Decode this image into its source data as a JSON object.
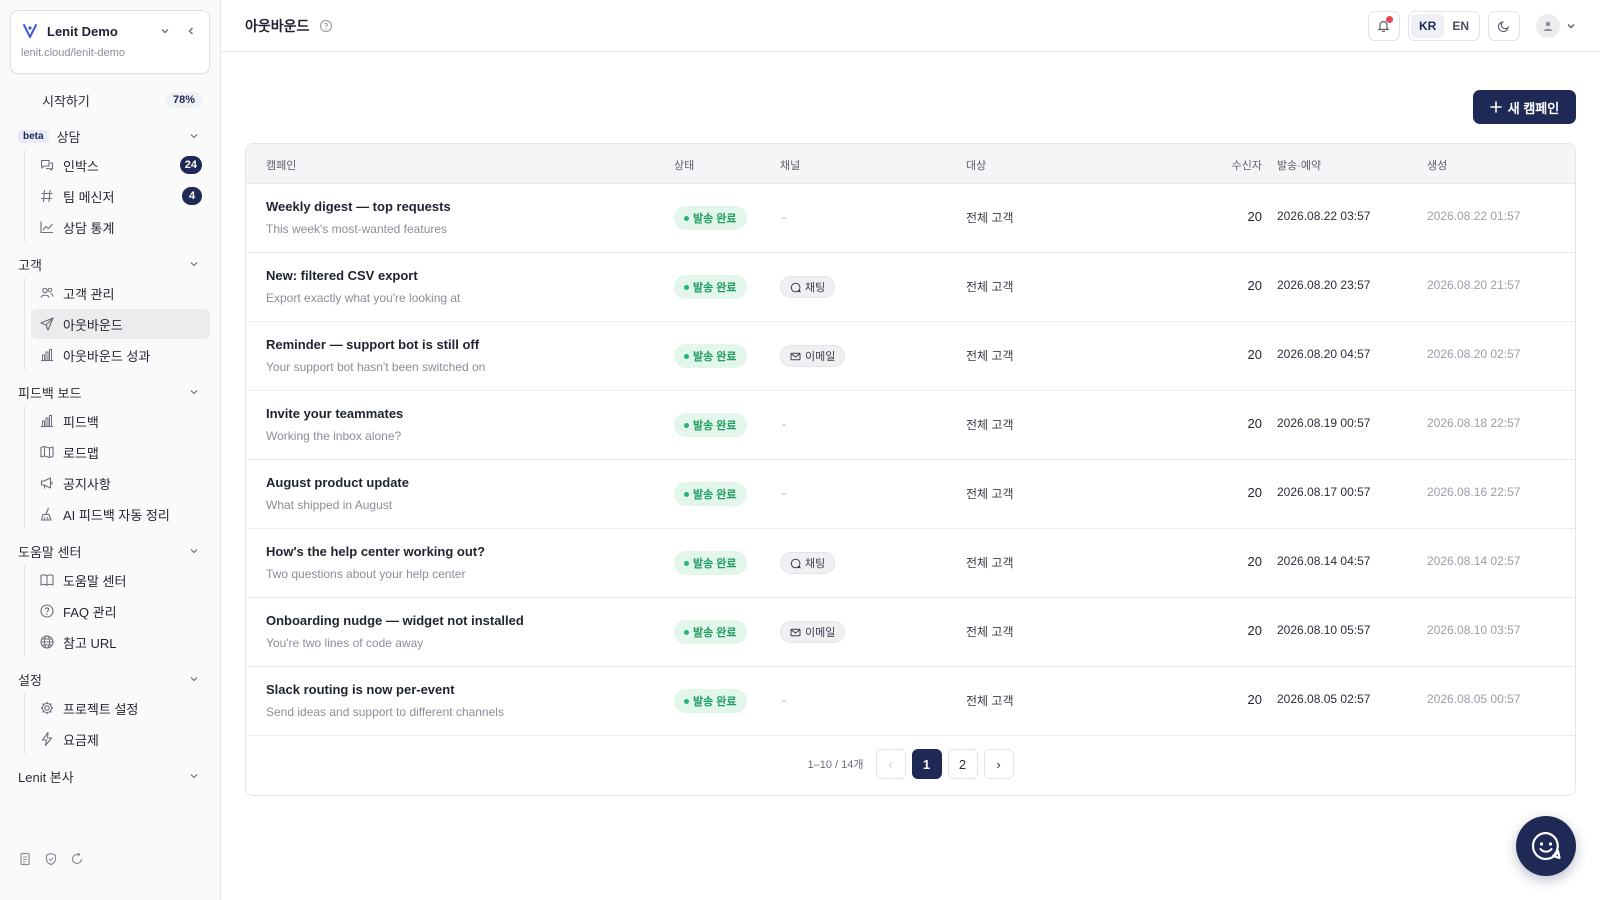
{
  "workspace": {
    "name": "Lenit Demo",
    "url": "lenit.cloud/lenit-demo"
  },
  "sidebar": {
    "start": {
      "label": "시작하기",
      "progress": "78%"
    },
    "sections": [
      {
        "title": "상담",
        "beta": "beta",
        "items": [
          {
            "label": "인박스",
            "icon": "chat-bubbles-icon",
            "badge": "24"
          },
          {
            "label": "팀 메신저",
            "icon": "hash-icon",
            "badge": "4"
          },
          {
            "label": "상담 통계",
            "icon": "line-chart-icon"
          }
        ]
      },
      {
        "title": "고객",
        "items": [
          {
            "label": "고객 관리",
            "icon": "users-icon"
          },
          {
            "label": "아웃바운드",
            "icon": "send-icon",
            "active": true
          },
          {
            "label": "아웃바운드 성과",
            "icon": "bar-chart-icon"
          }
        ]
      },
      {
        "title": "피드백 보드",
        "items": [
          {
            "label": "피드백",
            "icon": "bar-chart-icon"
          },
          {
            "label": "로드맵",
            "icon": "map-icon"
          },
          {
            "label": "공지사항",
            "icon": "megaphone-icon"
          },
          {
            "label": "AI 피드백 자동 정리",
            "icon": "ai-broom-icon"
          }
        ]
      },
      {
        "title": "도움말 센터",
        "items": [
          {
            "label": "도움말 센터",
            "icon": "book-icon"
          },
          {
            "label": "FAQ 관리",
            "icon": "question-icon"
          },
          {
            "label": "참고 URL",
            "icon": "globe-icon"
          }
        ]
      },
      {
        "title": "설정",
        "items": [
          {
            "label": "프로젝트 설정",
            "icon": "gear-icon"
          },
          {
            "label": "요금제",
            "icon": "bolt-icon"
          }
        ]
      },
      {
        "title": "Lenit 본사",
        "items": []
      }
    ]
  },
  "header": {
    "title": "아웃바운드",
    "lang_kr": "KR",
    "lang_en": "EN",
    "selected_lang": "KR"
  },
  "actions": {
    "new_campaign": "새 캠페인"
  },
  "table": {
    "columns": {
      "campaign": "캠페인",
      "status": "상태",
      "channel": "채널",
      "target": "대상",
      "recipients": "수신자",
      "sent": "발송·예약",
      "created": "생성"
    },
    "rows": [
      {
        "title": "Weekly digest — top requests",
        "subtitle": "This week's most-wanted features",
        "status": "발송 완료",
        "channel": "-",
        "channel_icon": "",
        "target": "전체 고객",
        "recipients": "20",
        "sent": "2026.08.22 03:57",
        "created": "2026.08.22 01:57"
      },
      {
        "title": "New: filtered CSV export",
        "subtitle": "Export exactly what you're looking at",
        "status": "발송 완료",
        "channel": "채팅",
        "channel_icon": "chat",
        "target": "전체 고객",
        "recipients": "20",
        "sent": "2026.08.20 23:57",
        "created": "2026.08.20 21:57"
      },
      {
        "title": "Reminder — support bot is still off",
        "subtitle": "Your support bot hasn't been switched on",
        "status": "발송 완료",
        "channel": "이메일",
        "channel_icon": "mail",
        "target": "전체 고객",
        "recipients": "20",
        "sent": "2026.08.20 04:57",
        "created": "2026.08.20 02:57"
      },
      {
        "title": "Invite your teammates",
        "subtitle": "Working the inbox alone?",
        "status": "발송 완료",
        "channel": "-",
        "channel_icon": "",
        "target": "전체 고객",
        "recipients": "20",
        "sent": "2026.08.19 00:57",
        "created": "2026.08.18 22:57"
      },
      {
        "title": "August product update",
        "subtitle": "What shipped in August",
        "status": "발송 완료",
        "channel": "-",
        "channel_icon": "",
        "target": "전체 고객",
        "recipients": "20",
        "sent": "2026.08.17 00:57",
        "created": "2026.08.16 22:57"
      },
      {
        "title": "How's the help center working out?",
        "subtitle": "Two questions about your help center",
        "status": "발송 완료",
        "channel": "채팅",
        "channel_icon": "chat",
        "target": "전체 고객",
        "recipients": "20",
        "sent": "2026.08.14 04:57",
        "created": "2026.08.14 02:57"
      },
      {
        "title": "Onboarding nudge — widget not installed",
        "subtitle": "You're two lines of code away",
        "status": "발송 완료",
        "channel": "이메일",
        "channel_icon": "mail",
        "target": "전체 고객",
        "recipients": "20",
        "sent": "2026.08.10 05:57",
        "created": "2026.08.10 03:57"
      },
      {
        "title": "Slack routing is now per-event",
        "subtitle": "Send ideas and support to different channels",
        "status": "발송 완료",
        "channel": "-",
        "channel_icon": "",
        "target": "전체 고객",
        "recipients": "20",
        "sent": "2026.08.05 02:57",
        "created": "2026.08.05 00:57"
      }
    ]
  },
  "pagination": {
    "info": "1–10 / 14개",
    "prev": "‹",
    "pages": [
      "1",
      "2"
    ],
    "current": "1",
    "next": "›"
  },
  "colors": {
    "brand": "#1e2a55",
    "status_green": "#1f9d61",
    "notification": "#e5484d"
  }
}
